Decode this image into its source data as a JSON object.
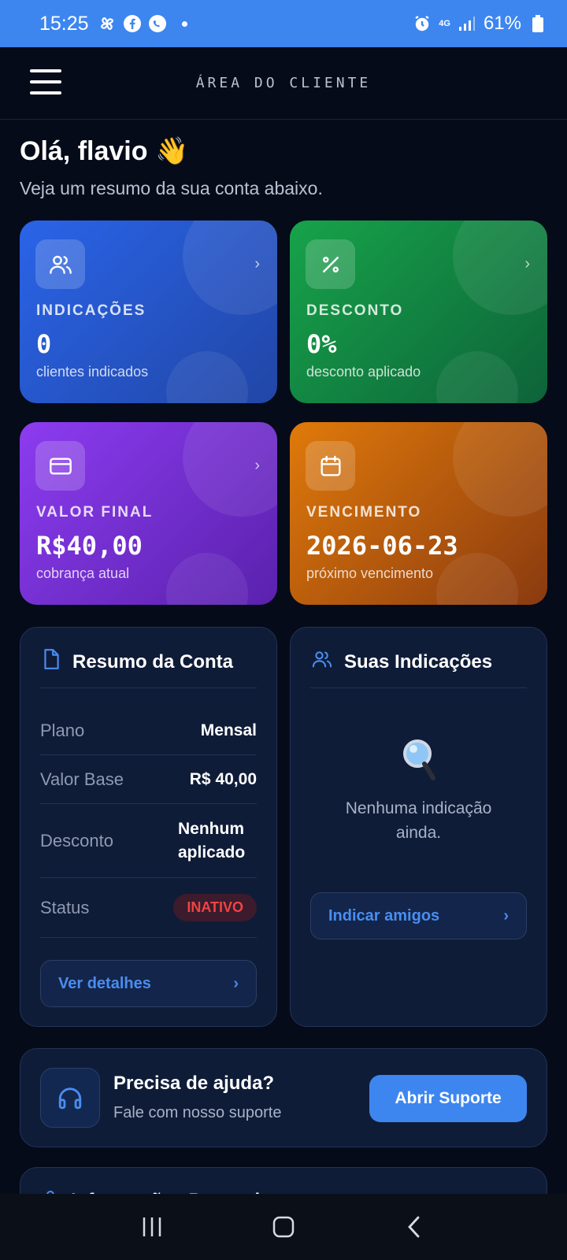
{
  "status_bar": {
    "time": "15:25",
    "battery": "61%",
    "network": "4G"
  },
  "header": {
    "title": "ÁREA DO CLIENTE"
  },
  "greeting": {
    "title": "Olá, flavio 👋",
    "subtitle": "Veja um resumo da sua conta abaixo."
  },
  "stats": [
    {
      "label": "INDICAÇÕES",
      "value": "0",
      "sub": "clientes indicados",
      "icon": "users-icon",
      "color_from": "#2a64e8",
      "color_to": "#2146a6"
    },
    {
      "label": "DESCONTO",
      "value": "0%",
      "sub": "desconto aplicado",
      "icon": "percent-icon",
      "color_from": "#17a34a",
      "color_to": "#0d6339"
    },
    {
      "label": "VALOR FINAL",
      "value": "R$40,00",
      "sub": "cobrança atual",
      "icon": "credit-card-icon",
      "color_from": "#8c3cf0",
      "color_to": "#5a21ad"
    },
    {
      "label": "VENCIMENTO",
      "value": "2026-06-23",
      "sub": "próximo vencimento",
      "icon": "calendar-icon",
      "color_from": "#e07a0a",
      "color_to": "#8a3a10"
    }
  ],
  "summary": {
    "title": "Resumo da Conta",
    "rows": [
      {
        "key": "Plano",
        "value": "Mensal"
      },
      {
        "key": "Valor Base",
        "value": "R$ 40,00"
      },
      {
        "key": "Desconto",
        "value": "Nenhum aplicado"
      },
      {
        "key": "Status",
        "value": "INATIVO"
      }
    ],
    "button": "Ver detalhes"
  },
  "referrals": {
    "title": "Suas Indicações",
    "empty_icon": "🔍",
    "empty_text": "Nenhuma indicação ainda.",
    "button": "Indicar amigos"
  },
  "help": {
    "title": "Precisa de ajuda?",
    "subtitle": "Fale com nosso suporte",
    "button": "Abrir Suporte"
  },
  "next_section": {
    "title": "Informações Pessoais"
  },
  "colors": {
    "background": "#050b19",
    "accent": "#3d86f0",
    "panel": "#0f1c38",
    "danger": "#ef4444"
  }
}
